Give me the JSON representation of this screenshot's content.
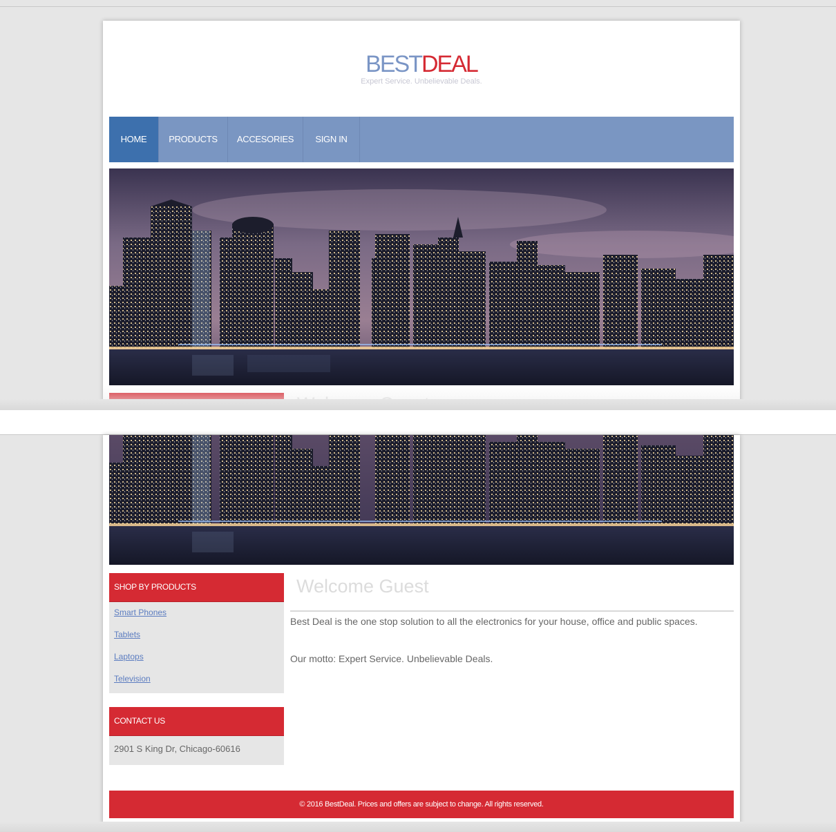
{
  "brand": {
    "name_part1": "BEST",
    "name_part2": "DEAL",
    "tagline": "Expert Service. Unbelievable Deals.",
    "color_primary": "#7a95c5",
    "color_accent": "#d52a33"
  },
  "nav": {
    "items": [
      {
        "label": "HOME",
        "active": true
      },
      {
        "label": "PRODUCTS",
        "active": false
      },
      {
        "label": "ACCESORIES",
        "active": false
      },
      {
        "label": "SIGN IN",
        "active": false
      }
    ]
  },
  "hero": {
    "image_subject": "night city skyline over water"
  },
  "sidebar": {
    "products_header": "SHOP BY PRODUCTS",
    "products": [
      {
        "label": "Smart Phones"
      },
      {
        "label": "Tablets"
      },
      {
        "label": "Laptops"
      },
      {
        "label": "Television"
      }
    ],
    "contact_header": "CONTACT US",
    "contact_address": "2901 S King Dr, Chicago-60616"
  },
  "main": {
    "welcome": "Welcome Guest",
    "intro": "Best Deal is the one stop solution to all the electronics for your house, office and public spaces.",
    "motto": "Our motto: Expert Service. Unbelievable Deals."
  },
  "footer": {
    "text": "© 2016 BestDeal. Prices and offers are subject to change. All rights reserved."
  }
}
